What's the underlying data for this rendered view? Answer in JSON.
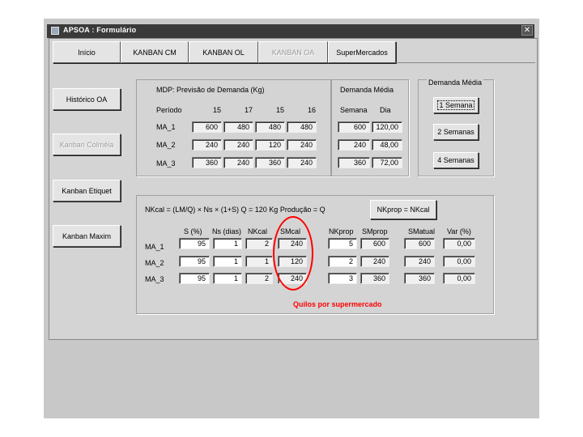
{
  "window": {
    "title": "APSOA : Formulário",
    "close_glyph": "✕"
  },
  "tabs": [
    {
      "label": "Início"
    },
    {
      "label": "KANBAN CM"
    },
    {
      "label": "KANBAN OL"
    },
    {
      "label": "KANBAN OA"
    },
    {
      "label": "SuperMercados"
    }
  ],
  "side_buttons": [
    {
      "label": "Histórico OA"
    },
    {
      "label": "Kanban Colméia"
    },
    {
      "label": "Kanban Etiquet"
    },
    {
      "label": "Kanban Maxim"
    }
  ],
  "forecast": {
    "title": "MDP: Previsão de Demanda (Kg)",
    "row_header": "Período",
    "periods": [
      "15",
      "17",
      "15",
      "16"
    ],
    "rows": [
      {
        "label": "MA_1",
        "values": [
          "600",
          "480",
          "480",
          "480"
        ]
      },
      {
        "label": "MA_2",
        "values": [
          "240",
          "240",
          "120",
          "240"
        ]
      },
      {
        "label": "MA_3",
        "values": [
          "360",
          "240",
          "360",
          "240"
        ]
      }
    ]
  },
  "avg_demand": {
    "title": "Demanda Média",
    "headers": [
      "Semana",
      "Dia"
    ],
    "rows": [
      [
        "600",
        "120,00"
      ],
      [
        "240",
        "48,00"
      ],
      [
        "360",
        "72,00"
      ]
    ]
  },
  "demand_options": {
    "title": "Demanda Média",
    "buttons": [
      "1 Semana",
      "2 Semanas",
      "4 Semanas"
    ]
  },
  "calc": {
    "formula": "NKcal = (LM/Q) × Ns × (1+S)     Q = 120 Kg     Produção = Q",
    "button": "NKprop = NKcal",
    "headers": [
      "S (%)",
      "Ns (dias)",
      "NKcal",
      "SMcal",
      "NKprop",
      "SMprop",
      "SMatual",
      "Var (%)"
    ],
    "rows": [
      {
        "label": "MA_1",
        "s": "95",
        "ns": "1",
        "nkcal": "2",
        "smcal": "240",
        "nkprop": "5",
        "smprop": "600",
        "smatual": "600",
        "var": "0,00"
      },
      {
        "label": "MA_2",
        "s": "95",
        "ns": "1",
        "nkcal": "1",
        "smcal": "120",
        "nkprop": "2",
        "smprop": "240",
        "smatual": "240",
        "var": "0,00"
      },
      {
        "label": "MA_3",
        "s": "95",
        "ns": "1",
        "nkcal": "2",
        "smcal": "240",
        "nkprop": "3",
        "smprop": "360",
        "smatual": "360",
        "var": "0,00"
      }
    ],
    "annotation": "Quilos por supermercado"
  },
  "colors": {
    "annotation": "#ff0000",
    "window_bg": "#d4d4d4",
    "titlebar": "#3a3a3a"
  }
}
